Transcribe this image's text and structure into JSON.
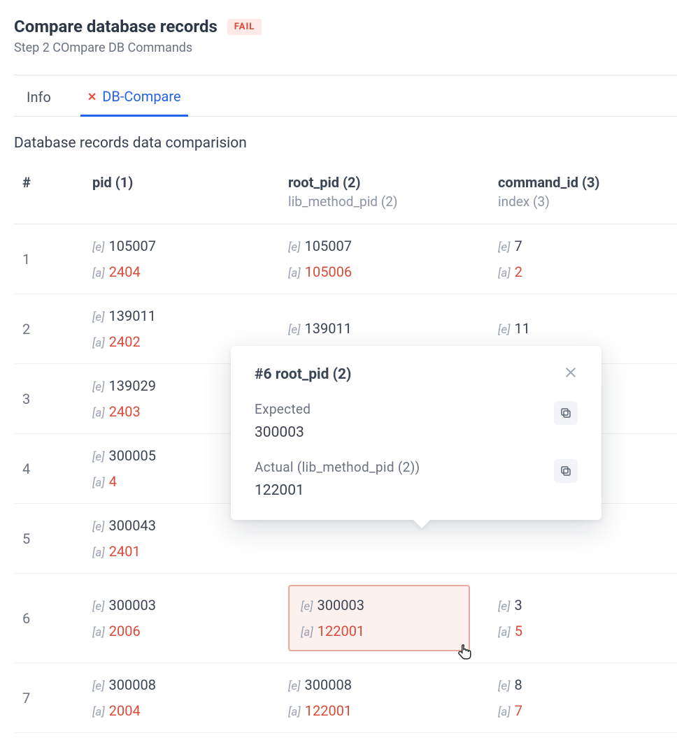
{
  "header": {
    "title": "Compare database records",
    "badge": "FAIL",
    "subtitle": "Step 2  COmpare DB Commands"
  },
  "tabs": {
    "info": "Info",
    "dbcompare": "DB-Compare"
  },
  "section_title": "Database records data comparision",
  "columns": {
    "num": "#",
    "pid": {
      "main": "pid (1)"
    },
    "root_pid": {
      "main": "root_pid (2)",
      "sub": "lib_method_pid (2)"
    },
    "command_id": {
      "main": "command_id (3)",
      "sub": "index (3)"
    }
  },
  "rows": [
    {
      "n": "1",
      "pid_e": "105007",
      "pid_a": "2404",
      "root_e": "105007",
      "root_a": "105006",
      "cmd_e": "7",
      "cmd_a": "2"
    },
    {
      "n": "2",
      "pid_e": "139011",
      "pid_a": "2402",
      "root_e": "139011",
      "root_a": "",
      "cmd_e": "11",
      "cmd_a": ""
    },
    {
      "n": "3",
      "pid_e": "139029",
      "pid_a": "2403",
      "root_e": "",
      "root_a": "",
      "cmd_e": "",
      "cmd_a": ""
    },
    {
      "n": "4",
      "pid_e": "300005",
      "pid_a": "4",
      "root_e": "",
      "root_a": "",
      "cmd_e": "",
      "cmd_a": ""
    },
    {
      "n": "5",
      "pid_e": "300043",
      "pid_a": "2401",
      "root_e": "",
      "root_a": "",
      "cmd_e": "",
      "cmd_a": ""
    },
    {
      "n": "6",
      "pid_e": "300003",
      "pid_a": "2006",
      "root_e": "300003",
      "root_a": "122001",
      "cmd_e": "3",
      "cmd_a": "5"
    },
    {
      "n": "7",
      "pid_e": "300008",
      "pid_a": "2004",
      "root_e": "300008",
      "root_a": "122001",
      "cmd_e": "8",
      "cmd_a": "7"
    }
  ],
  "tags": {
    "e": "[e]",
    "a": "[a]"
  },
  "popover": {
    "title": "#6   root_pid (2)",
    "expected_label": "Expected",
    "expected_value": "300003",
    "actual_label": "Actual (lib_method_pid (2))",
    "actual_value": "122001"
  }
}
